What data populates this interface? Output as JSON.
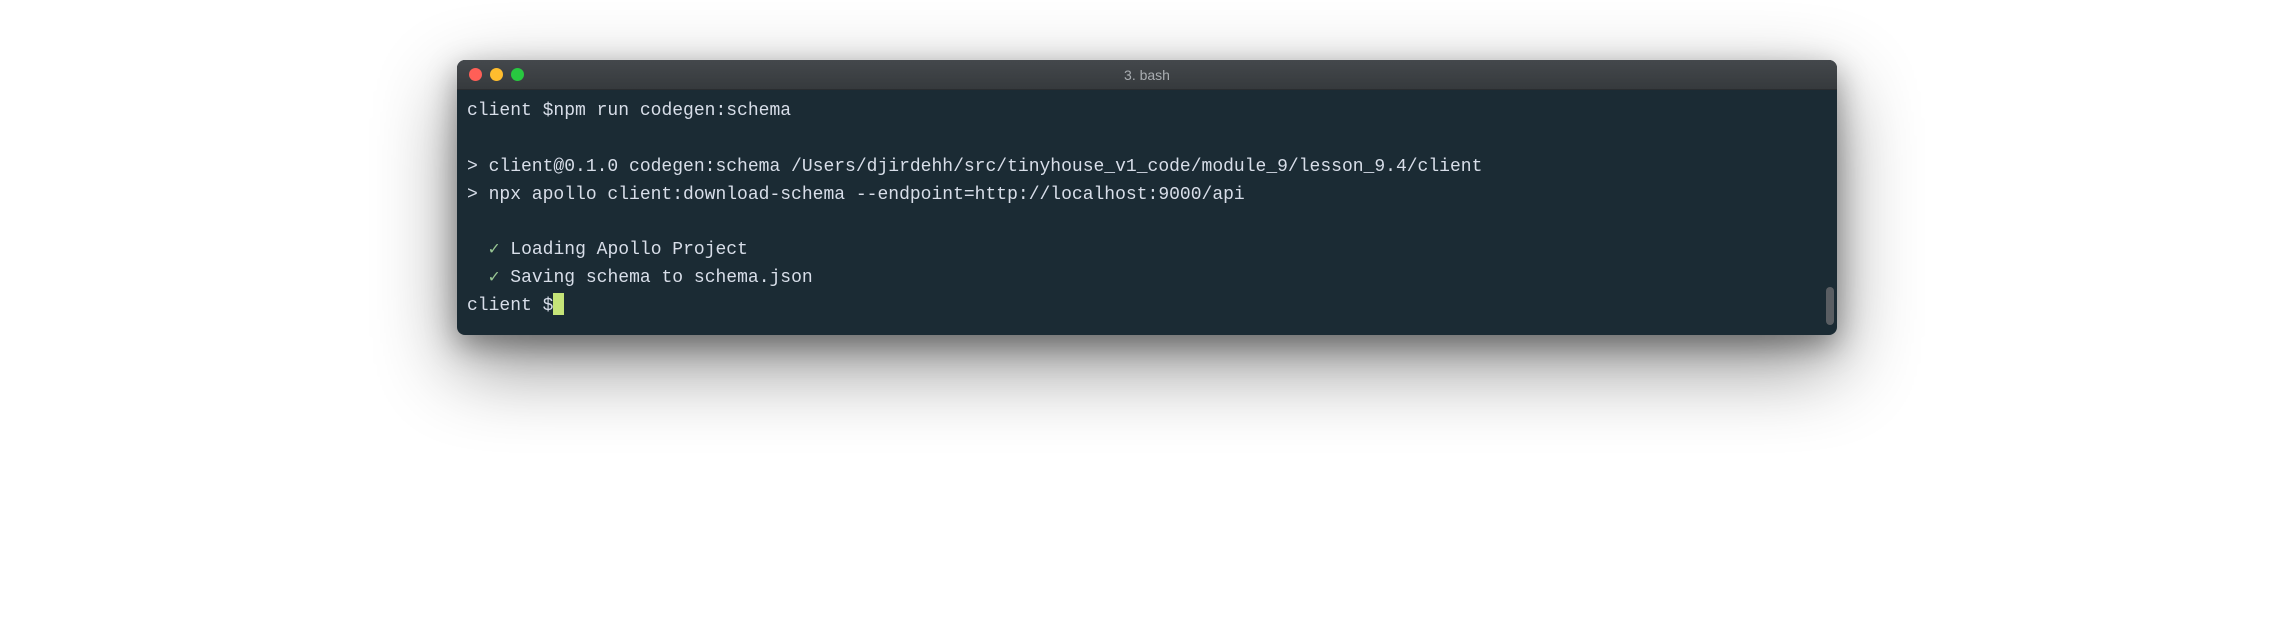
{
  "window": {
    "title": "3. bash"
  },
  "terminal": {
    "lines": [
      {
        "prompt": "client $",
        "command": "npm run codegen:schema"
      },
      {
        "blank": true
      },
      {
        "text": "> client@0.1.0 codegen:schema /Users/djirdehh/src/tinyhouse_v1_code/module_9/lesson_9.4/client"
      },
      {
        "text": "> npx apollo client:download-schema --endpoint=http://localhost:9000/api"
      },
      {
        "blank": true
      },
      {
        "check": true,
        "text": "Loading Apollo Project"
      },
      {
        "check": true,
        "text": "Saving schema to schema.json"
      },
      {
        "prompt": "client $",
        "cursor": true
      }
    ],
    "check_glyph": "✓"
  }
}
